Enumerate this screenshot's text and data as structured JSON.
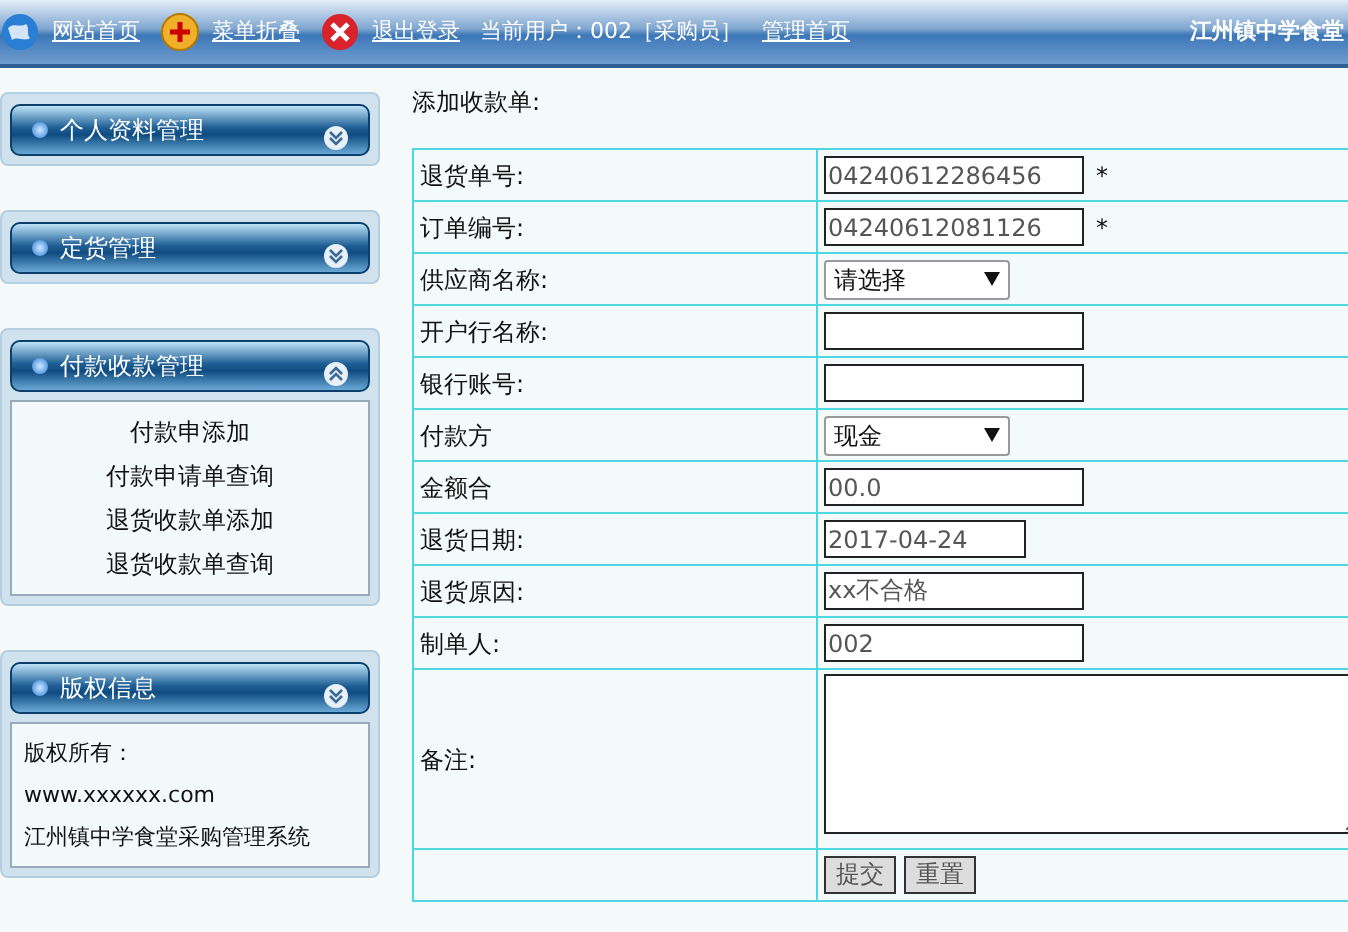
{
  "top_bar": {
    "links": [
      {
        "label": "网站首页"
      },
      {
        "label": "菜单折叠"
      },
      {
        "label": "退出登录"
      }
    ],
    "current_user": "当前用户：002［采购员］",
    "admin_link": "管理首页",
    "site_title": "江州镇中学食堂"
  },
  "sidebar": [
    {
      "title": "个人资料管理",
      "expanded": false
    },
    {
      "title": "定货管理",
      "expanded": false
    },
    {
      "title": "付款收款管理",
      "expanded": true,
      "kind": "menu",
      "items": [
        "付款申添加",
        "付款申请单查询",
        "退货收款单添加",
        "退货收款单查询"
      ]
    },
    {
      "title": "版权信息",
      "expanded": false,
      "kind": "info",
      "lines": [
        "版权所有：",
        "www.xxxxxx.com",
        "江州镇中学食堂采购管理系统"
      ]
    }
  ],
  "form": {
    "title": "添加收款单:",
    "rows": [
      {
        "label": "退货单号:",
        "kind": "input",
        "value": "04240612286456",
        "required_mark": "*"
      },
      {
        "label": "订单编号:",
        "kind": "input",
        "value": "04240612081126",
        "required_mark": "*"
      },
      {
        "label": "供应商名称:",
        "kind": "select",
        "value": "请选择"
      },
      {
        "label": "开户行名称:",
        "kind": "input",
        "value": ""
      },
      {
        "label": "银行账号:",
        "kind": "input",
        "value": ""
      },
      {
        "label": "付款方",
        "kind": "select",
        "value": "现金"
      },
      {
        "label": "金额合",
        "kind": "input",
        "value": "00.0"
      },
      {
        "label": "退货日期:",
        "kind": "date",
        "value": "2017-04-24"
      },
      {
        "label": "退货原因:",
        "kind": "input",
        "value": "xx不合格"
      },
      {
        "label": "制单人:",
        "kind": "input",
        "value": "002"
      },
      {
        "label": "备注:",
        "kind": "textarea",
        "value": ""
      },
      {
        "label": "",
        "kind": "buttons",
        "buttons": [
          "提交",
          "重置"
        ]
      }
    ]
  }
}
